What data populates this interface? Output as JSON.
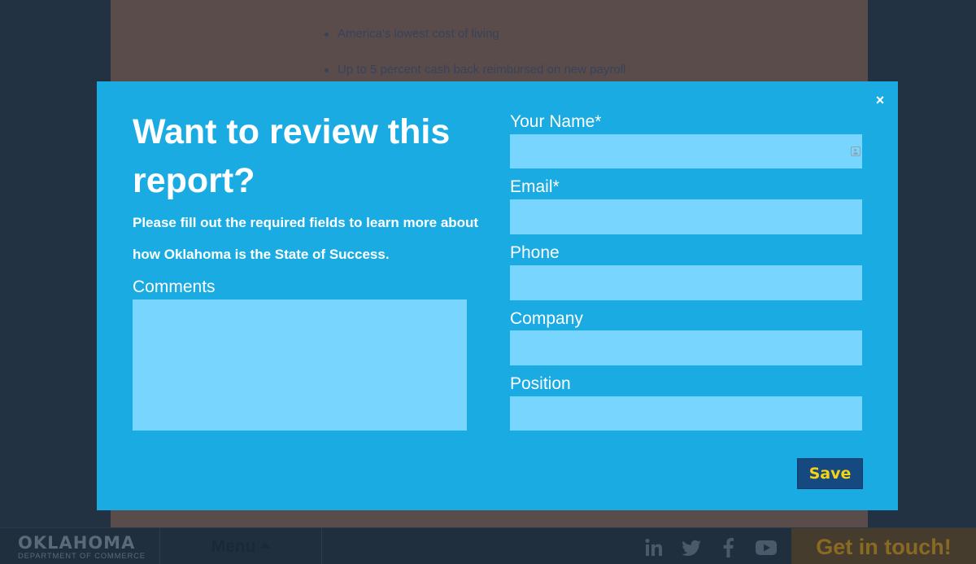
{
  "background": {
    "bullets": [
      "America's lowest cost of living",
      "Up to 5 percent cash back reimbursed on new payroll"
    ]
  },
  "modal": {
    "close_icon": "×",
    "title": "Want to review this report?",
    "description": "Please fill out the required fields to learn more about how Oklahoma is the State of Success.",
    "comments_label": "Comments",
    "fields": {
      "name_label": "Your Name*",
      "email_label": "Email*",
      "phone_label": "Phone",
      "company_label": "Company",
      "position_label": "Position"
    },
    "save_label": "Save"
  },
  "footer": {
    "logo_main": "OKLAHOMA",
    "logo_sub": "DEPARTMENT OF COMMERCE",
    "menu_label": "Menu",
    "social": [
      "linkedin-icon",
      "twitter-icon",
      "facebook-icon",
      "youtube-icon"
    ],
    "cta_label": "Get in touch!"
  },
  "colors": {
    "modal_bg": "#1aabe3",
    "input_bg": "#78d6fe",
    "save_bg": "#15497f",
    "save_text": "#f7d213",
    "cta_text": "#8a6a22"
  }
}
